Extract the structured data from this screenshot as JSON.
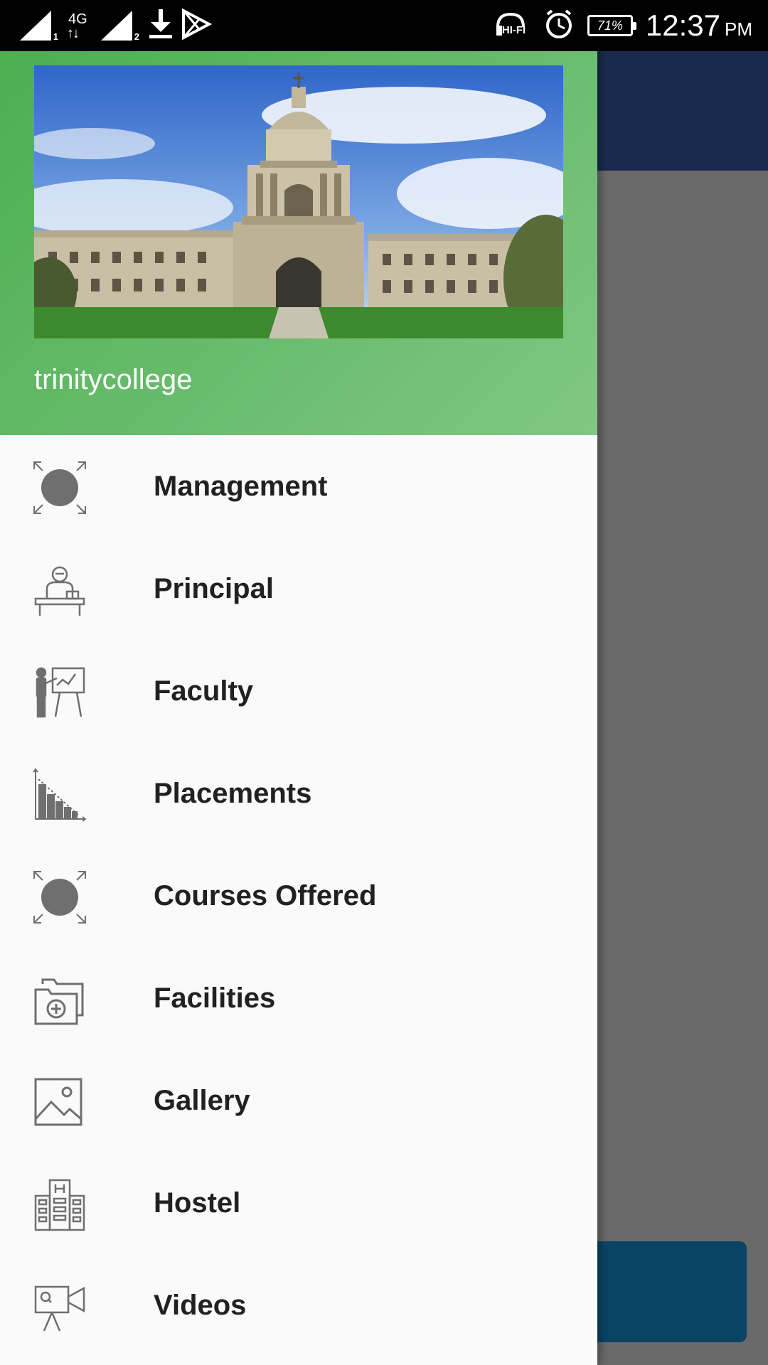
{
  "status_bar": {
    "sim1": "1",
    "sim2": "2",
    "network": "4G",
    "network_arrows": "↑↓",
    "audio": "HI-FI",
    "battery": "71%",
    "time": "12:37",
    "ampm": "PM"
  },
  "drawer": {
    "header": {
      "title": "trinitycollege",
      "image": "trinity-college-campanile-photo"
    },
    "items": [
      {
        "label": "Management",
        "icon": "placeholder-circle-icon"
      },
      {
        "label": "Principal",
        "icon": "principal-desk-icon"
      },
      {
        "label": "Faculty",
        "icon": "teacher-board-icon"
      },
      {
        "label": "Placements",
        "icon": "bar-chart-icon"
      },
      {
        "label": "Courses Offered",
        "icon": "placeholder-circle-icon"
      },
      {
        "label": "Facilities",
        "icon": "folder-add-icon"
      },
      {
        "label": "Gallery",
        "icon": "image-icon"
      },
      {
        "label": "Hostel",
        "icon": "building-icon"
      },
      {
        "label": "Videos",
        "icon": "video-camera-icon"
      }
    ]
  },
  "colors": {
    "drawer_header_start": "#4caf50",
    "drawer_header_end": "#81c784",
    "app_bar": "#1a2a4e",
    "icon_gray": "#6f6f6f",
    "fab_blue": "#0a4465"
  }
}
